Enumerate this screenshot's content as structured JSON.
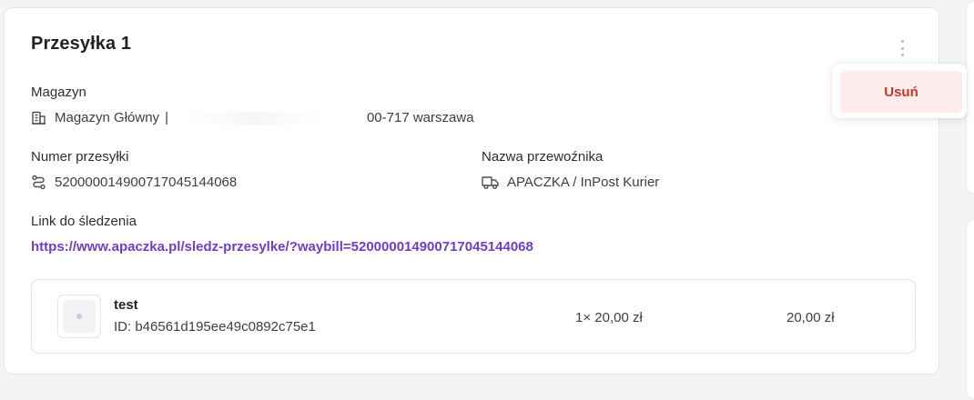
{
  "shipment": {
    "title": "Przesyłka 1",
    "warehouse": {
      "label": "Magazyn",
      "name": "Magazyn Główny",
      "separator": "|",
      "postal_city": "00-717 warszawa"
    },
    "tracking_number": {
      "label": "Numer przesyłki",
      "value": "52000001490071704514406 8"
    },
    "carrier": {
      "label": "Nazwa przewoźnika",
      "value": "APACZKA / InPost Kurier"
    },
    "tracking_link": {
      "label": "Link do śledzenia",
      "url": "https://www.apaczka.pl/sledz-przesylke/?waybill=520000014900717045144068"
    },
    "item": {
      "name": "test",
      "id": "ID: b46561d195ee49c0892c75e1",
      "quantity_price": "1× 20,00 zł",
      "total": "20,00 zł"
    }
  },
  "menu": {
    "remove_label": "Usuń"
  },
  "icons": {
    "warehouse": "building-icon",
    "tracking": "route-icon",
    "carrier": "truck-icon",
    "menu": "kebab-menu-icon",
    "thumbnail": "image-placeholder-icon"
  },
  "colors": {
    "link": "#6d3fc7",
    "danger_text": "#c0392b",
    "danger_bg": "#fdeceb"
  }
}
